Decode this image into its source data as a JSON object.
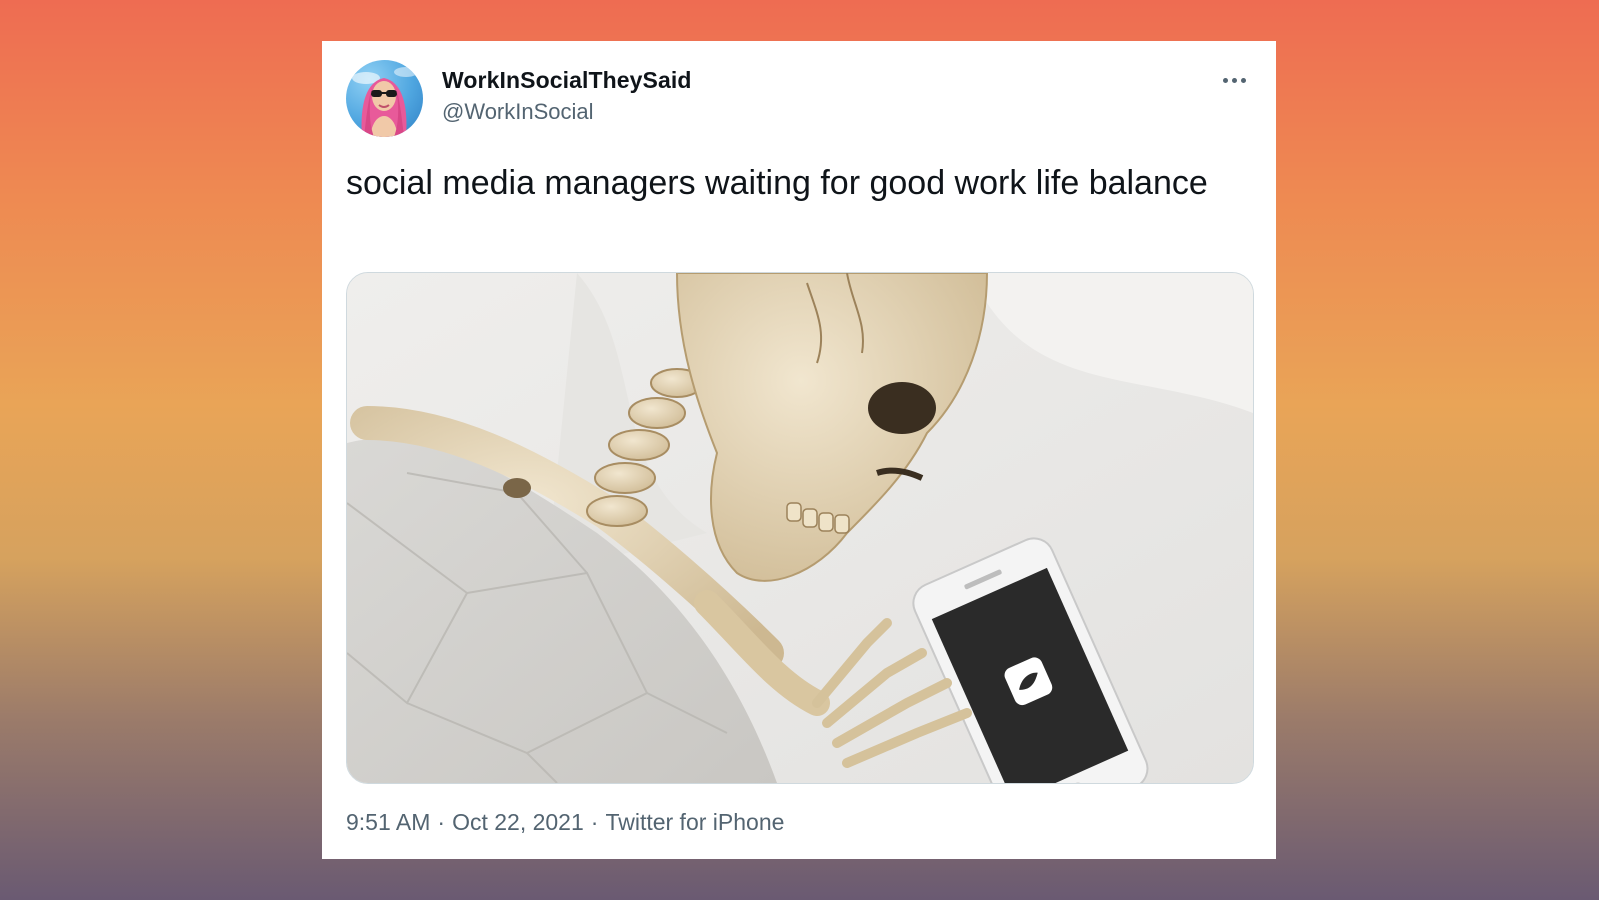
{
  "colors": {
    "background_top": "#ee6c52",
    "background_bottom": "#6a5a72",
    "card": "#ffffff",
    "text_primary": "#0f1419",
    "text_secondary": "#536471"
  },
  "tweet": {
    "author": {
      "display_name": "WorkInSocialTheySaid",
      "handle": "@WorkInSocial",
      "avatar_icon": "avatar-pink-hair-sunglasses"
    },
    "more_icon": "more-horizontal-icon",
    "text": "social media managers waiting for good work life balance",
    "media": {
      "icon": "skeleton-in-bed-with-phone-photo"
    },
    "meta": {
      "time": "9:51 AM",
      "date": "Oct 22, 2021",
      "source": "Twitter for iPhone",
      "separator": "·"
    }
  }
}
